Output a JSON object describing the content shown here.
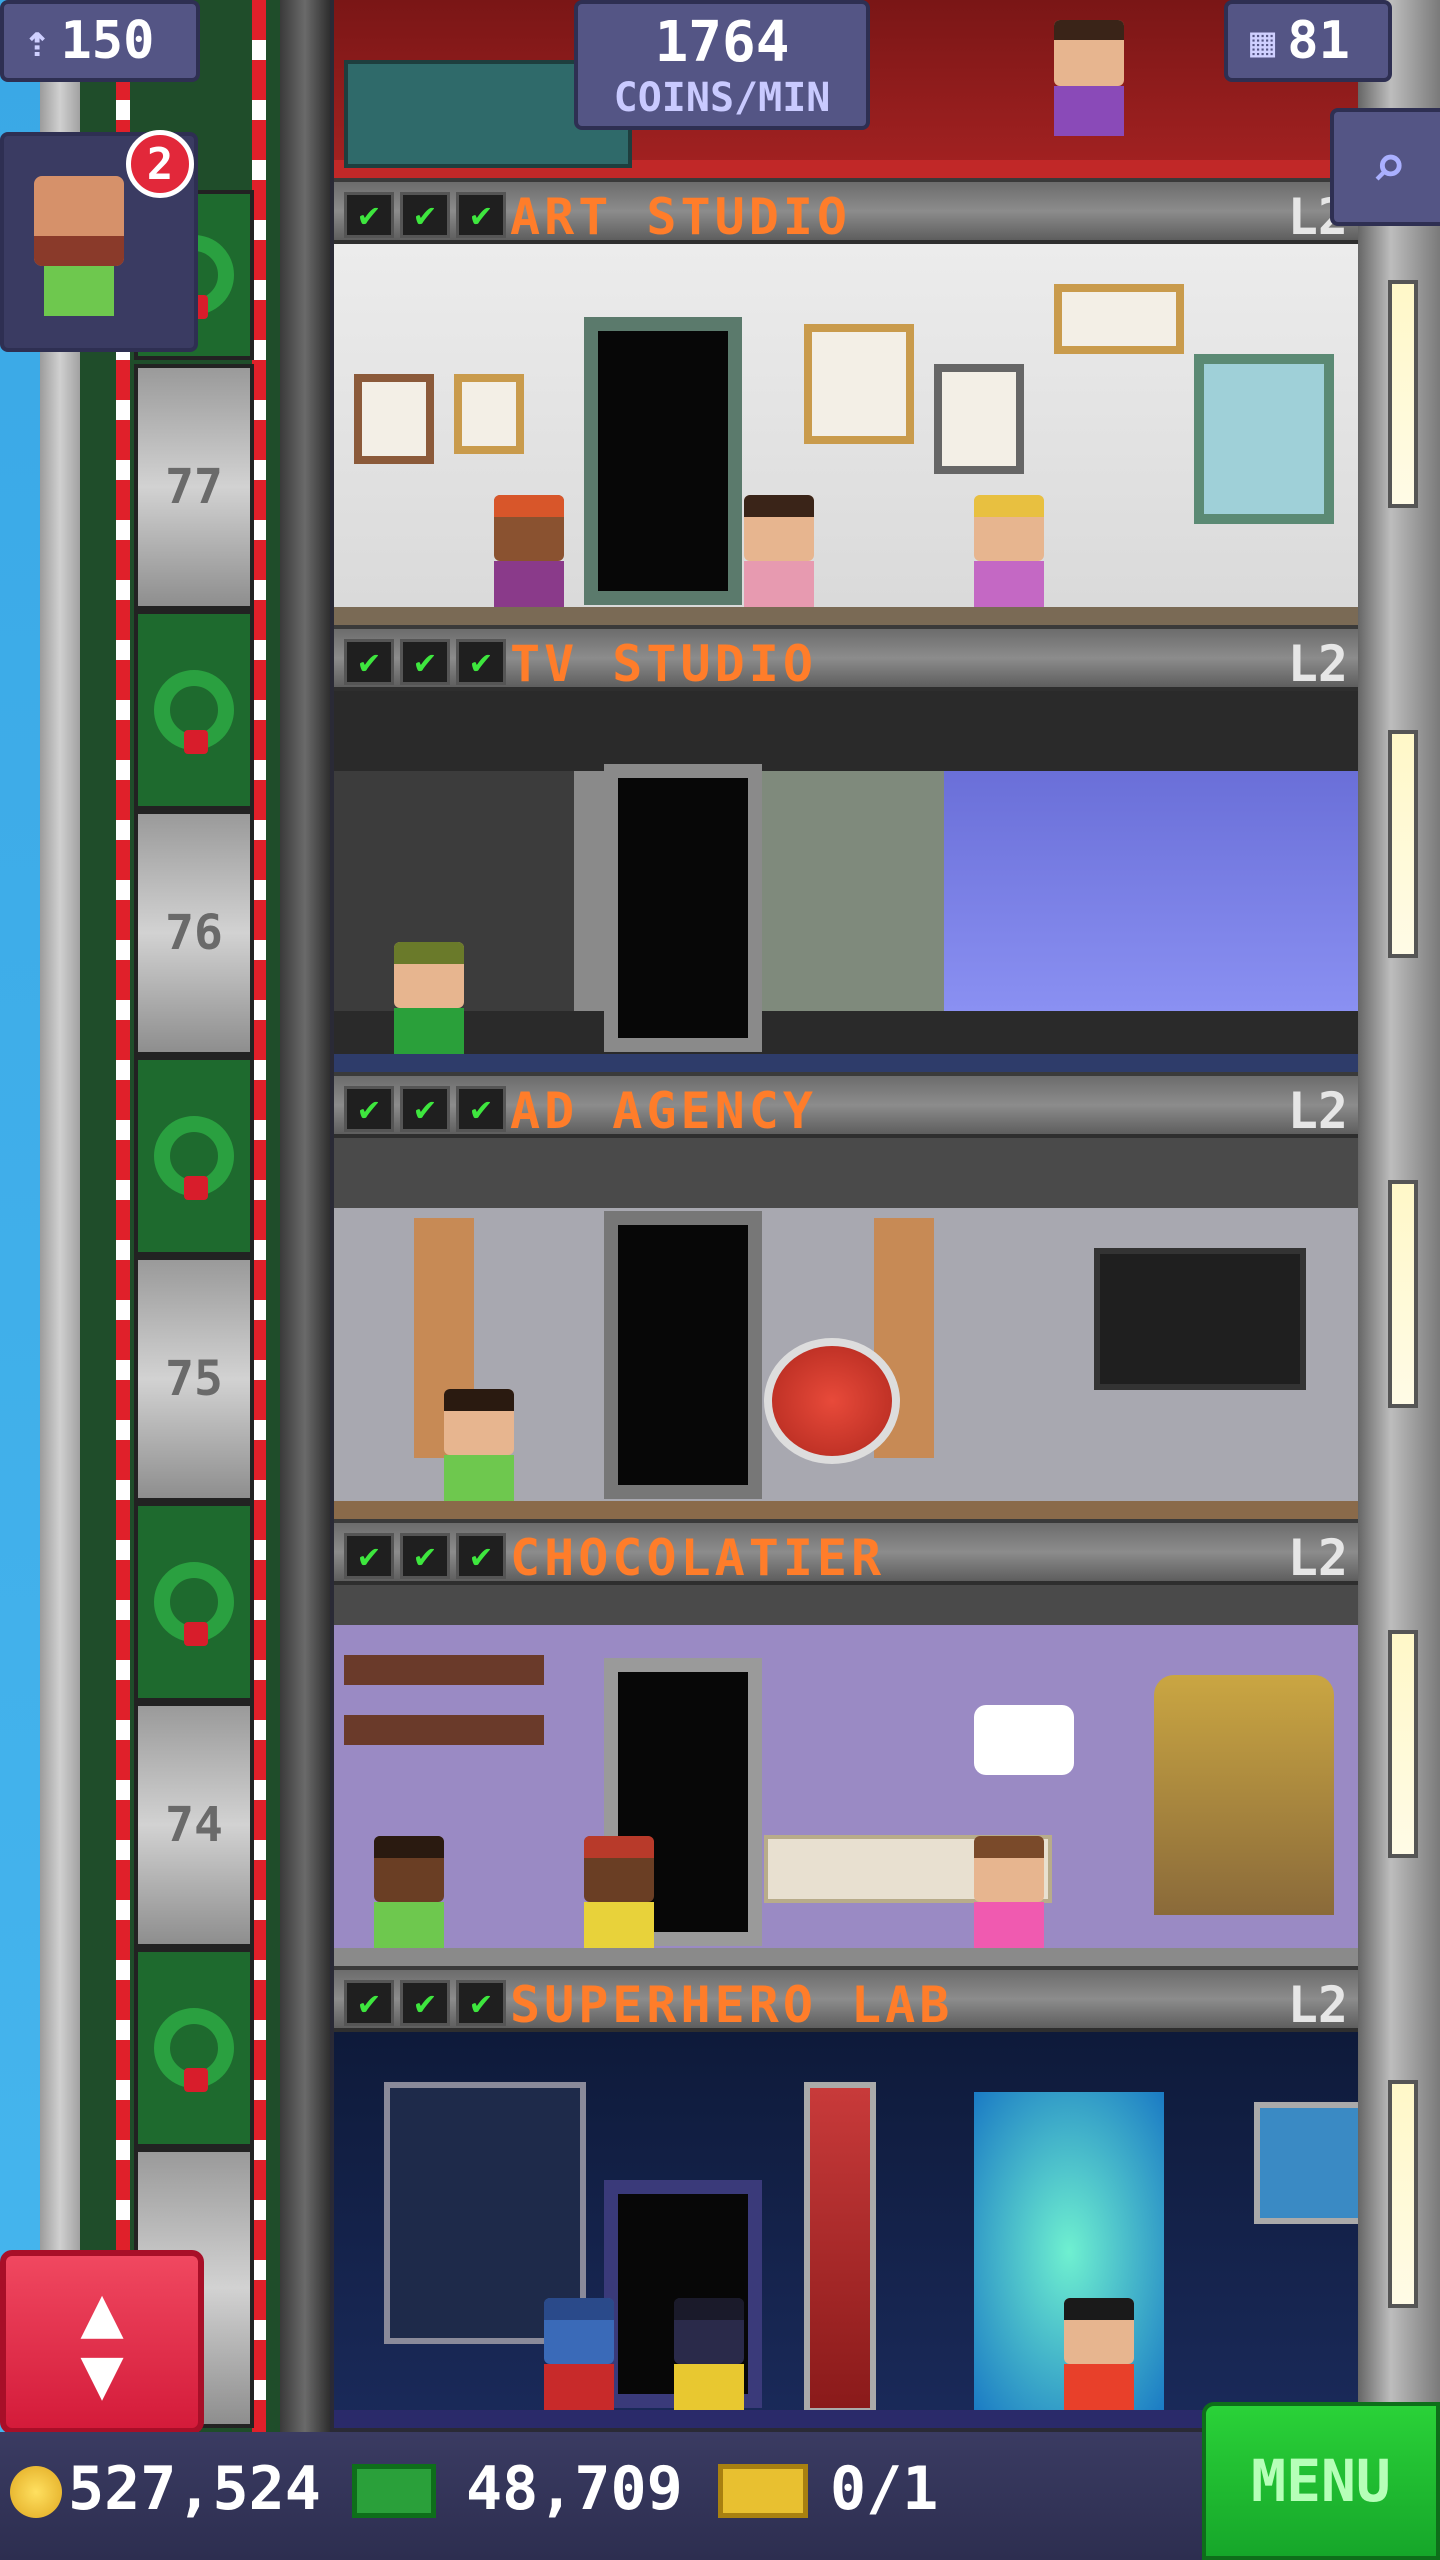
{
  "hud": {
    "population": "150",
    "population_icon": "person-up-icon",
    "coins_per_min_value": "1764",
    "coins_per_min_label": "COINS/MIN",
    "floors_count": "81",
    "floors_icon": "building-icon",
    "search_icon": "magnifier-icon",
    "notification_badge": "2"
  },
  "elevator": {
    "floor_numbers": [
      "77",
      "76",
      "75",
      "74"
    ]
  },
  "floors": [
    {
      "name": "ART STUDIO",
      "level": "L2",
      "stars": [
        "✔",
        "✔",
        "✔"
      ]
    },
    {
      "name": "TV STUDIO",
      "level": "L2",
      "stars": [
        "✔",
        "✔",
        "✔"
      ]
    },
    {
      "name": "AD AGENCY",
      "level": "L2",
      "stars": [
        "✔",
        "✔",
        "✔"
      ]
    },
    {
      "name": "CHOCOLATIER",
      "level": "L2",
      "stars": [
        "✔",
        "✔",
        "✔"
      ]
    },
    {
      "name": "SUPERHERO LAB",
      "level": "L2",
      "stars": [
        "✔",
        "✔",
        "✔"
      ]
    }
  ],
  "bottom": {
    "coins": "527,524",
    "bux": "48,709",
    "tickets": "0/1",
    "menu_label": "MENU"
  },
  "colors": {
    "floor_title": "#ff7d2a",
    "check": "#3ee63e",
    "menu_green": "#2ad238",
    "elevator_red": "#e0202a"
  }
}
